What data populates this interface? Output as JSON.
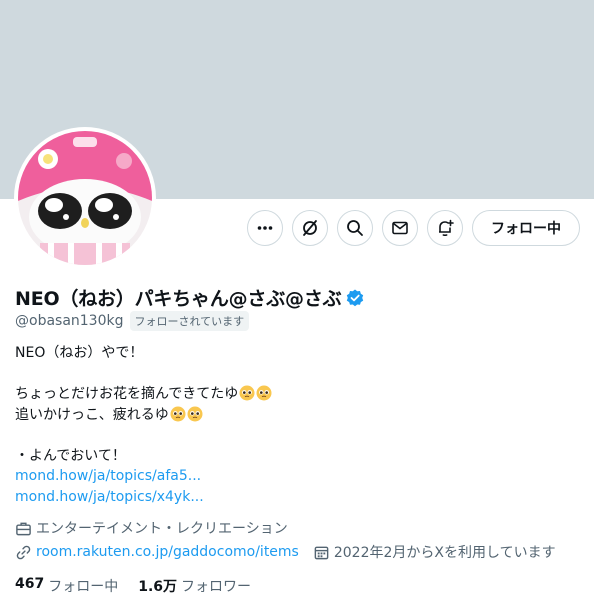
{
  "profile": {
    "display_name": "NEO（ねお）パキちゃん@さぶ@さぶ",
    "handle": "@obasan130kg",
    "follows_you_badge": "フォローされています",
    "follow_button_label": "フォロー中",
    "bio": {
      "line1": "NEO（ねお）やで！",
      "line2": "ちょっとだけお花を摘んできてたゆ",
      "line3": "追いかけっこ、疲れるゆ",
      "line4": "・よんでおいて！",
      "link1": "mond.how/ja/topics/afa5...",
      "link2": "mond.how/ja/topics/x4yk..."
    },
    "category": "エンターテイメント・レクリエーション",
    "website": "room.rakuten.co.jp/gaddocomo/items",
    "joined": "2022年2月からXを利用しています",
    "stats": {
      "following_count": "467",
      "following_label": "フォロー中",
      "followers_count": "1.6万",
      "followers_label": "フォロワー"
    }
  },
  "icons": {
    "more": "more-icon",
    "grok": "grok-icon",
    "search": "search-icon",
    "message": "mail-icon",
    "notify": "bell-plus-icon",
    "verified": "verified-badge-icon",
    "category": "briefcase-icon",
    "link": "link-icon",
    "calendar": "calendar-icon",
    "emoji": "pleading-face-emoji"
  },
  "colors": {
    "banner": "#cfd9de",
    "accent": "#1d9bf0",
    "text_primary": "#0f1419",
    "text_secondary": "#536471",
    "avatar_pink": "#f0609e"
  }
}
